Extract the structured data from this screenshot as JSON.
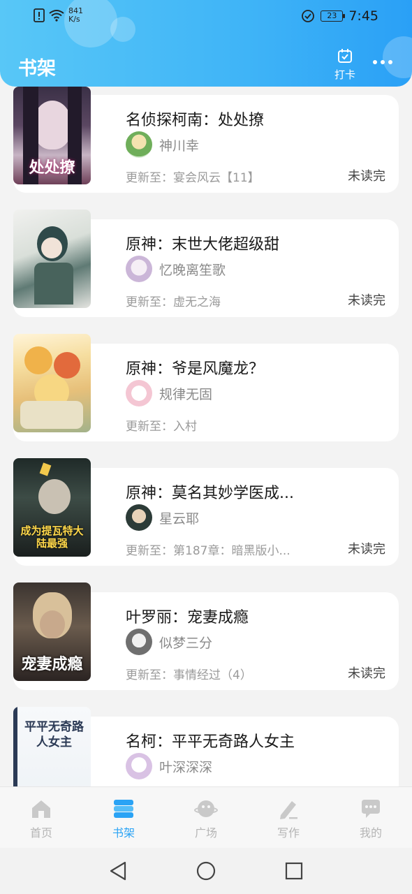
{
  "status_bar": {
    "speed_value": "841",
    "speed_unit": "K/s",
    "battery": "23",
    "time": "7:45"
  },
  "header": {
    "title": "书架",
    "checkin_label": "打卡"
  },
  "books": [
    {
      "title": "名侦探柯南：处处撩",
      "author": "神川幸",
      "update": "更新至：宴会风云【11】",
      "status": "未读完",
      "cover_text": "处处撩"
    },
    {
      "title": "原神：末世大佬超级甜",
      "author": "忆晚离笙歌",
      "update": "更新至：虚无之海",
      "status": "未读完",
      "cover_text": ""
    },
    {
      "title": "原神：爷是风魔龙？",
      "author": "规律无固",
      "update": "更新至：入村",
      "status": "",
      "cover_text": ""
    },
    {
      "title": "原神：莫名其妙学医成...",
      "author": "星云耶",
      "update": "更新至：第187章：暗黑版小...",
      "status": "未读完",
      "cover_text": "成为提瓦特大陆最强"
    },
    {
      "title": "叶罗丽：宠妻成瘾",
      "author": "似梦三分",
      "update": "更新至：事情经过（4）",
      "status": "未读完",
      "cover_text": "宠妻成瘾"
    },
    {
      "title": "名柯：平平无奇路人女主",
      "author": "叶深深深",
      "update": "",
      "status": "",
      "cover_text": "平平无奇路人女主"
    }
  ],
  "nav": [
    {
      "label": "首页",
      "icon": "home-icon"
    },
    {
      "label": "书架",
      "icon": "bookshelf-icon"
    },
    {
      "label": "广场",
      "icon": "planet-icon"
    },
    {
      "label": "写作",
      "icon": "pen-icon"
    },
    {
      "label": "我的",
      "icon": "chat-bubble-icon"
    }
  ],
  "colors": {
    "header_start": "#58c7f7",
    "header_end": "#2aa0f6",
    "accent": "#2aa3f5",
    "inactive": "#b5b5b5"
  }
}
